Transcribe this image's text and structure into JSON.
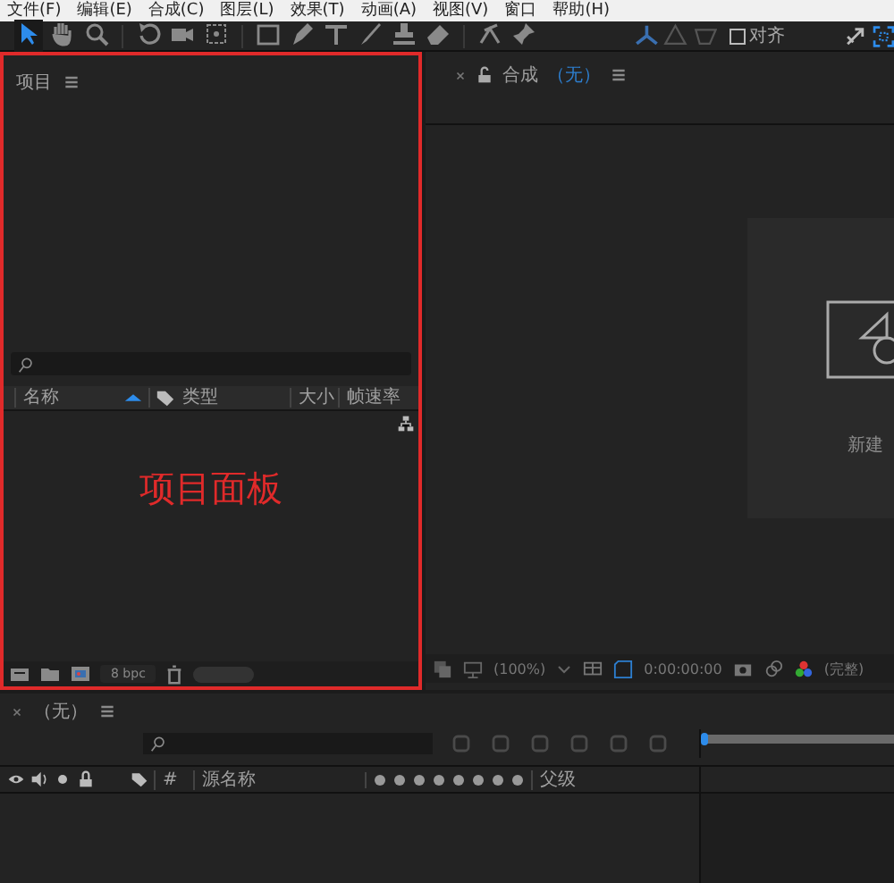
{
  "menu_bar": [
    "文件(F)",
    "编辑(E)",
    "合成(C)",
    "图层(L)",
    "效果(T)",
    "动画(A)",
    "视图(V)",
    "窗口",
    "帮助(H)"
  ],
  "toolbar": {
    "tools": [
      {
        "kind": "arrow",
        "selected": true
      },
      {
        "kind": "hand",
        "selected": false
      },
      {
        "kind": "zoom",
        "selected": false
      },
      {
        "kind": "rotate",
        "selected": false
      },
      {
        "kind": "camera",
        "selected": false
      },
      {
        "kind": "pan",
        "selected": false
      },
      {
        "kind": "rect",
        "selected": false
      },
      {
        "kind": "pen",
        "selected": false
      },
      {
        "kind": "text",
        "selected": false
      },
      {
        "kind": "brush",
        "selected": false
      },
      {
        "kind": "stamp",
        "selected": false
      },
      {
        "kind": "eraser",
        "selected": false
      },
      {
        "kind": "roto",
        "selected": false
      },
      {
        "kind": "pin",
        "selected": false
      }
    ],
    "snap": {
      "label": "对齐",
      "checked": false
    }
  },
  "project_panel": {
    "title": "项目",
    "columns": [
      "名称",
      "类型",
      "大小",
      "帧速率"
    ],
    "annotation": "项目面板",
    "bit_depth": "8 bpc",
    "thumbnail_slider": {
      "level": 1
    }
  },
  "composition_panel": {
    "title": "合成",
    "name": "（无）",
    "new_composition": "新建",
    "zoom": "(100%)",
    "timecode": "0:00:00:00",
    "resolution": "(完整)"
  },
  "timeline_panel": {
    "name": "（无）",
    "columns": [
      "#",
      "源名称",
      "父级"
    ]
  }
}
